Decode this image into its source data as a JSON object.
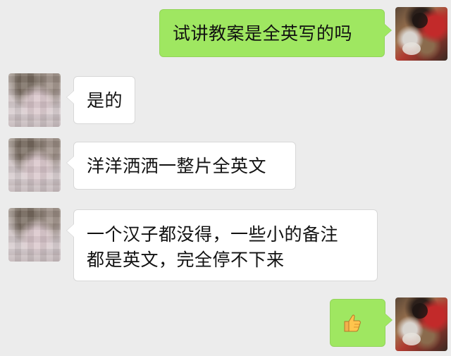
{
  "chat": {
    "messages": [
      {
        "from": "me",
        "text": "试讲教案是全英写的吗"
      },
      {
        "from": "contact",
        "text": "是的"
      },
      {
        "from": "contact",
        "text": "洋洋洒洒一整片全英文"
      },
      {
        "from": "contact",
        "lines": [
          "一个汉子都没得，一些小的备注",
          "都是英文，完全停不下来"
        ]
      },
      {
        "from": "me",
        "emoji": "thumbs-up-icon"
      }
    ]
  },
  "colors": {
    "background": "#ececec",
    "outgoing_bubble": "#9fe761",
    "incoming_bubble": "#ffffff"
  }
}
